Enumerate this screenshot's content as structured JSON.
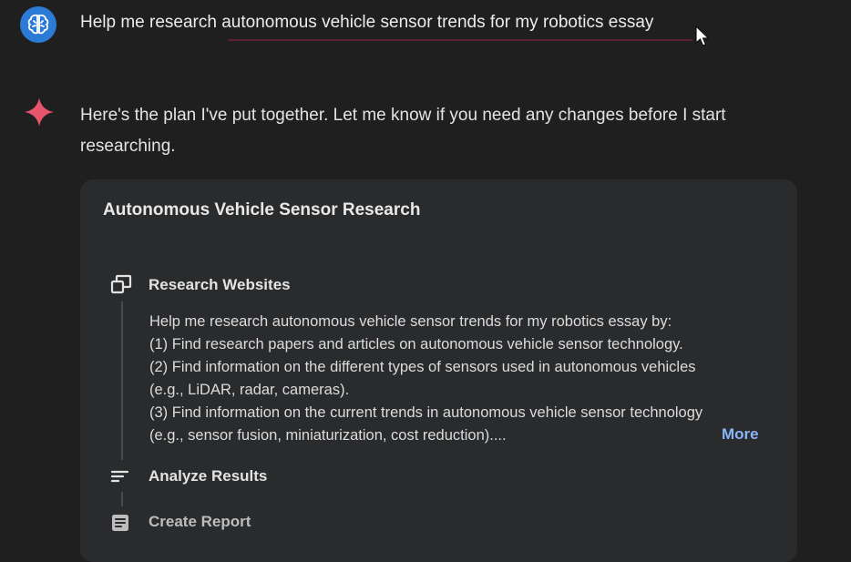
{
  "conversation": {
    "user_prompt": "Help me research autonomous vehicle sensor trends for my robotics essay",
    "assistant_reply": "Here's the plan I've put together. Let me know if you need any changes before I start researching."
  },
  "plan_card": {
    "title": "Autonomous Vehicle Sensor Research",
    "steps": [
      {
        "label": "Research Websites",
        "icon": "web-windows-icon"
      },
      {
        "label": "Analyze Results",
        "icon": "sort-lines-icon"
      },
      {
        "label": "Create Report",
        "icon": "document-icon"
      }
    ],
    "plan_lines": [
      "Help me research autonomous vehicle sensor trends for my robotics essay by:",
      "(1) Find research papers and articles on autonomous vehicle sensor technology.",
      "(2) Find information on the different types of sensors used in autonomous vehicles",
      "(e.g., LiDAR, radar, cameras).",
      "(3) Find information on the current trends in autonomous vehicle sensor technology",
      "(e.g., sensor fusion, miniaturization, cost reduction)...."
    ],
    "more_label": "More"
  },
  "colors": {
    "background": "#1f1f1f",
    "card": "#2a2b2d",
    "link": "#8ab4f8",
    "sparkle": "#e8546c",
    "avatar": "#2b7bd6"
  }
}
